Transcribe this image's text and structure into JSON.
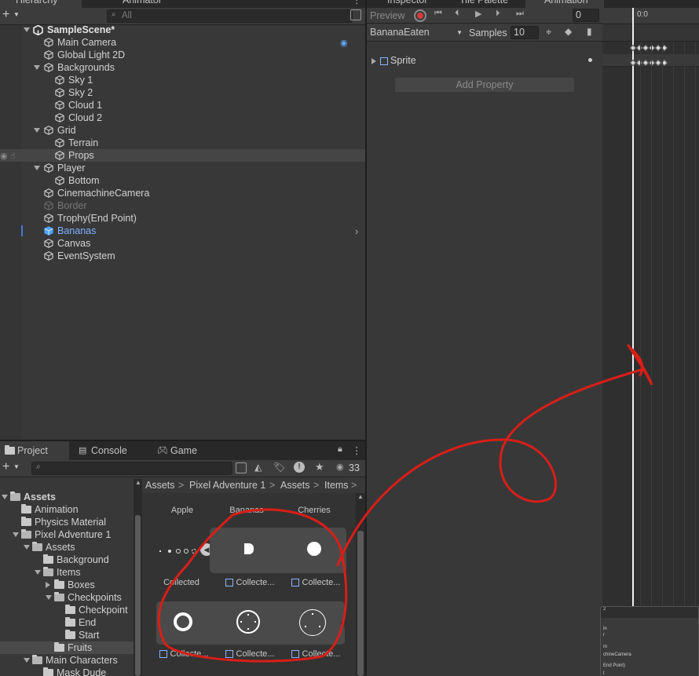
{
  "hierarchy": {
    "tabs": [
      {
        "label": "Hierarchy"
      },
      {
        "label": "Animator"
      }
    ],
    "search_placeholder": "All",
    "scene": "SampleScene*",
    "items": [
      {
        "label": "Main Camera",
        "depth": 1,
        "arrow": "none",
        "state": "normal"
      },
      {
        "label": "Global Light 2D",
        "depth": 1,
        "arrow": "none",
        "state": "normal"
      },
      {
        "label": "Backgrounds",
        "depth": 1,
        "arrow": "down",
        "state": "normal"
      },
      {
        "label": "Sky 1",
        "depth": 2,
        "arrow": "none",
        "state": "normal"
      },
      {
        "label": "Sky 2",
        "depth": 2,
        "arrow": "none",
        "state": "normal"
      },
      {
        "label": "Cloud 1",
        "depth": 2,
        "arrow": "none",
        "state": "normal"
      },
      {
        "label": "Cloud 2",
        "depth": 2,
        "arrow": "none",
        "state": "normal"
      },
      {
        "label": "Grid",
        "depth": 1,
        "arrow": "down",
        "state": "normal"
      },
      {
        "label": "Terrain",
        "depth": 2,
        "arrow": "none",
        "state": "normal"
      },
      {
        "label": "Props",
        "depth": 2,
        "arrow": "none",
        "state": "hover"
      },
      {
        "label": "Player",
        "depth": 1,
        "arrow": "down",
        "state": "normal"
      },
      {
        "label": "Bottom",
        "depth": 2,
        "arrow": "none",
        "state": "normal"
      },
      {
        "label": "CinemachineCamera",
        "depth": 1,
        "arrow": "none",
        "state": "normal"
      },
      {
        "label": "Border",
        "depth": 1,
        "arrow": "none",
        "state": "disabled"
      },
      {
        "label": "Trophy(End Point)",
        "depth": 1,
        "arrow": "none",
        "state": "normal"
      },
      {
        "label": "Bananas",
        "depth": 1,
        "arrow": "none",
        "state": "prefab"
      },
      {
        "label": "Canvas",
        "depth": 1,
        "arrow": "none",
        "state": "normal"
      },
      {
        "label": "EventSystem",
        "depth": 1,
        "arrow": "none",
        "state": "normal"
      }
    ]
  },
  "animation": {
    "tabs": [
      {
        "label": "Inspector"
      },
      {
        "label": "Tile Palette"
      },
      {
        "label": "Animation"
      }
    ],
    "preview_label": "Preview",
    "frame_value": "0",
    "clip_name": "BananaEaten",
    "samples_label": "Samples",
    "samples_value": "10",
    "property_label": "Sprite",
    "add_property_label": "Add Property",
    "timeline_label": "0:0",
    "inspector_fragment_lines": [
      "2",
      "in",
      "r",
      "m",
      "chineCamera",
      "End Point)",
      "t",
      "stem"
    ]
  },
  "project": {
    "tabs": [
      {
        "label": "Project"
      },
      {
        "label": "Console"
      },
      {
        "label": "Game"
      }
    ],
    "hidden_count": "33",
    "tree": [
      {
        "label": "Assets",
        "depth": 0,
        "arrow": "down",
        "bold": true
      },
      {
        "label": "Animation",
        "depth": 1,
        "arrow": "none",
        "bold": false
      },
      {
        "label": "Physics Material",
        "depth": 1,
        "arrow": "none",
        "bold": false
      },
      {
        "label": "Pixel Adventure 1",
        "depth": 1,
        "arrow": "down",
        "bold": false
      },
      {
        "label": "Assets",
        "depth": 2,
        "arrow": "down",
        "bold": false
      },
      {
        "label": "Background",
        "depth": 3,
        "arrow": "none",
        "bold": false
      },
      {
        "label": "Items",
        "depth": 3,
        "arrow": "down",
        "bold": false
      },
      {
        "label": "Boxes",
        "depth": 4,
        "arrow": "right",
        "bold": false
      },
      {
        "label": "Checkpoints",
        "depth": 4,
        "arrow": "down",
        "bold": false
      },
      {
        "label": "Checkpoint",
        "depth": 5,
        "arrow": "none",
        "bold": false
      },
      {
        "label": "End",
        "depth": 5,
        "arrow": "none",
        "bold": false
      },
      {
        "label": "Start",
        "depth": 5,
        "arrow": "none",
        "bold": false
      },
      {
        "label": "Fruits",
        "depth": 4,
        "arrow": "none",
        "bold": false
      },
      {
        "label": "Main Characters",
        "depth": 2,
        "arrow": "down",
        "bold": false
      },
      {
        "label": "Mask Dude",
        "depth": 3,
        "arrow": "none",
        "bold": false
      }
    ],
    "breadcrumb": [
      "Assets",
      "Pixel Adventure 1",
      "Assets",
      "Items"
    ],
    "breadcrumb_sep": ">",
    "grid_top_labels": [
      "Apple",
      "Bananas",
      "Cherries"
    ],
    "grid_mid_labels": [
      "Collected",
      "Collecte...",
      "Collecte..."
    ],
    "grid_bottom_labels": [
      "Collecte...",
      "Collecte...",
      "Collecte..."
    ]
  },
  "colors": {
    "annotation_red": "#d91e18",
    "prefab_blue": "#7fb0ff",
    "selection_accent": "#3d7bd6"
  }
}
